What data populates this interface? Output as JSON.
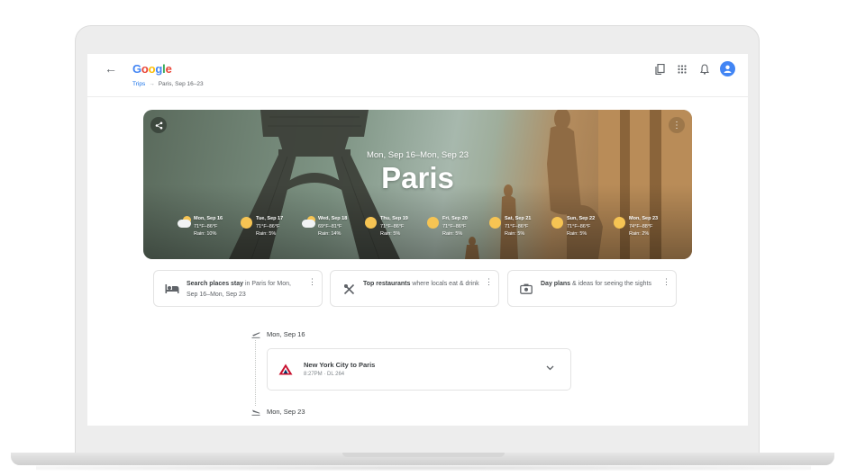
{
  "header": {
    "logo": [
      "G",
      "o",
      "o",
      "g",
      "l",
      "e"
    ],
    "logo_colors": [
      "#4285f4",
      "#ea4335",
      "#fbbc05",
      "#4285f4",
      "#34a853",
      "#ea4335"
    ],
    "breadcrumb_root": "Trips",
    "breadcrumb_arrow": "→",
    "breadcrumb_current": "Paris, Sep 16–23",
    "icons": [
      "arrow-back-icon",
      "bookmarks-icon",
      "apps-icon",
      "notifications-icon",
      "account-avatar"
    ]
  },
  "hero": {
    "dates": "Mon, Sep 16–Mon, Sep 23",
    "title": "Paris",
    "weather": [
      {
        "date": "Mon, Sep 16",
        "temp": "71°F–86°F",
        "rain": "Rain: 10%",
        "icon": "partly-cloudy"
      },
      {
        "date": "Tue, Sep 17",
        "temp": "71°F–86°F",
        "rain": "Rain: 5%",
        "icon": "sunny"
      },
      {
        "date": "Wed, Sep 18",
        "temp": "69°F–81°F",
        "rain": "Rain: 14%",
        "icon": "partly-cloudy"
      },
      {
        "date": "Thu, Sep 19",
        "temp": "71°F–86°F",
        "rain": "Rain: 5%",
        "icon": "sunny"
      },
      {
        "date": "Fri, Sep 20",
        "temp": "71°F–86°F",
        "rain": "Rain: 5%",
        "icon": "sunny"
      },
      {
        "date": "Sat, Sep 21",
        "temp": "71°F–86°F",
        "rain": "Rain: 5%",
        "icon": "sunny"
      },
      {
        "date": "Sun, Sep 22",
        "temp": "71°F–86°F",
        "rain": "Rain: 5%",
        "icon": "sunny"
      },
      {
        "date": "Mon, Sep 23",
        "temp": "74°F–88°F",
        "rain": "Rain: 2%",
        "icon": "sunny"
      }
    ]
  },
  "cards": [
    {
      "bold": "Search places stay",
      "rest": " in Paris for Mon, Sep 16–Mon, Sep 23",
      "icon": "hotel-icon"
    },
    {
      "bold": "Top restaurants",
      "rest": " where locals eat & drink",
      "icon": "restaurant-icon"
    },
    {
      "bold": "Day plans",
      "rest": " & ideas for seeing the sights",
      "icon": "camera-icon"
    }
  ],
  "timeline": {
    "day1": "Mon, Sep 16",
    "day2": "Mon, Sep 23",
    "flight": {
      "route": "New York City to Paris",
      "details": "8:27PM · DL 264"
    }
  }
}
